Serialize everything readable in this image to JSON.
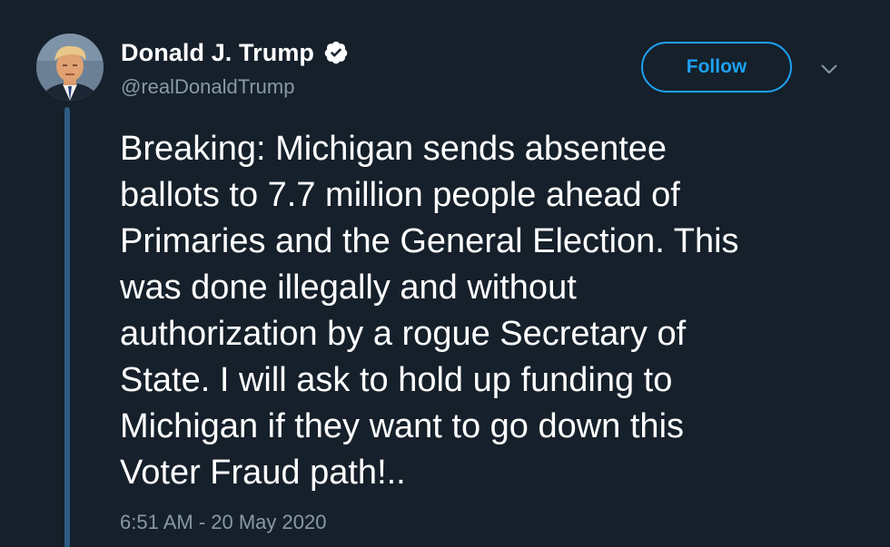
{
  "user": {
    "display_name": "Donald J. Trump",
    "handle": "@realDonaldTrump",
    "verified": true,
    "avatar_icon": "profile-photo"
  },
  "actions": {
    "follow_label": "Follow",
    "more_icon": "chevron-down-icon"
  },
  "tweet": {
    "text": "Breaking: Michigan sends absentee\nballots to 7.7 million people ahead of\nPrimaries and the General Election. This\nwas done illegally and without\nauthorization by a rogue Secretary of\nState. I will ask to hold up funding to\nMichigan if they want to go down this\nVoter Fraud path!..",
    "timestamp": "6:51 AM - 20 May 2020"
  },
  "colors": {
    "background": "#15202b",
    "accent": "#1da1f2",
    "secondary_text": "#8899a6",
    "thread_line": "#2d5a82"
  }
}
